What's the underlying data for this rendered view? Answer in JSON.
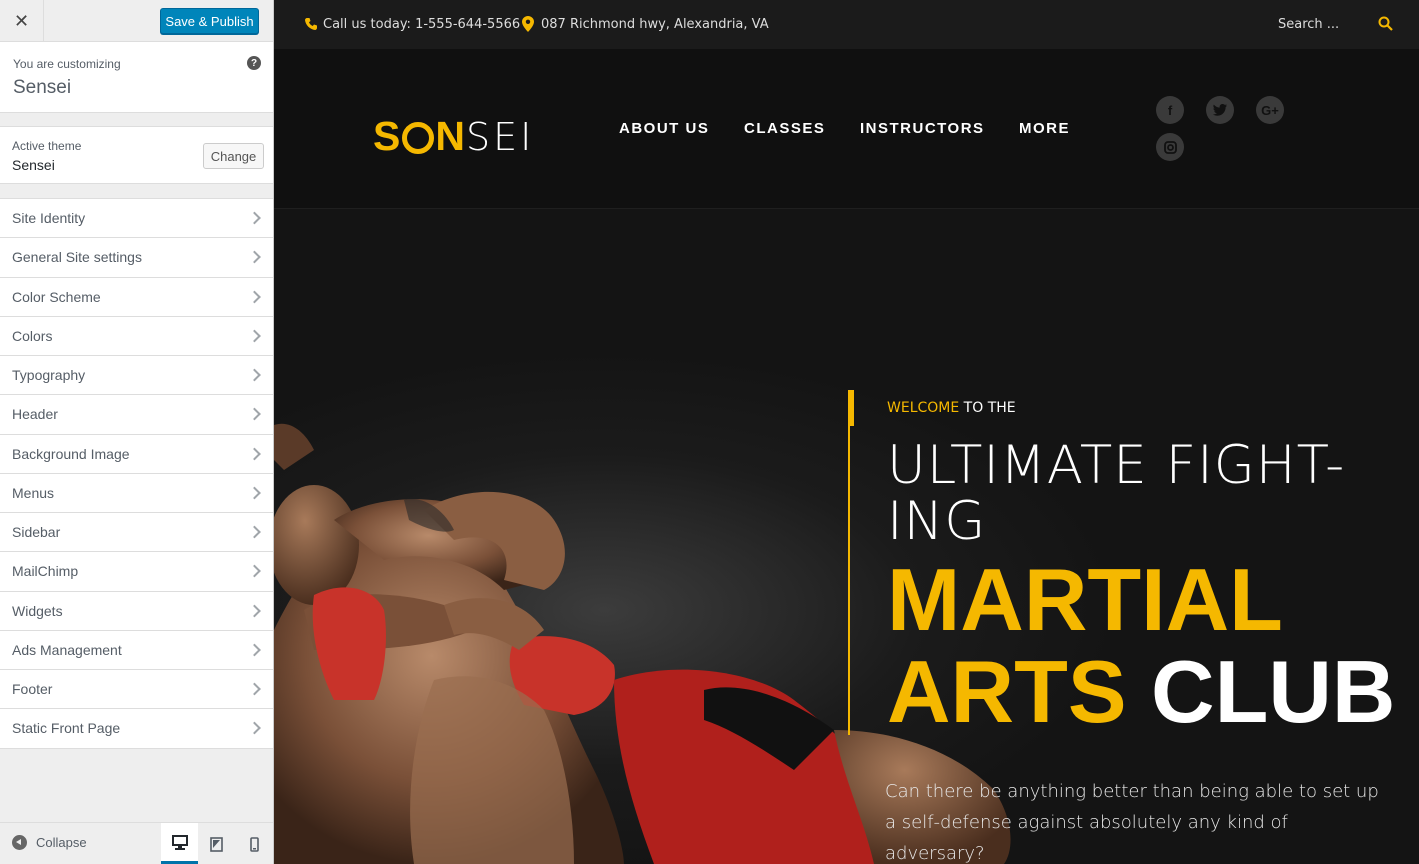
{
  "customizer": {
    "close_icon": "close-icon",
    "save_publish": "Save & Publish",
    "customizing_label": "You are customizing",
    "customizing_title": "Sensei",
    "help_icon": "?",
    "active_theme_label": "Active theme",
    "active_theme_name": "Sensei",
    "change_label": "Change",
    "sections": [
      "Site Identity",
      "General Site settings",
      "Color Scheme",
      "Colors",
      "Typography",
      "Header",
      "Background Image",
      "Menus",
      "Sidebar",
      "MailChimp",
      "Widgets",
      "Ads Management",
      "Footer",
      "Static Front Page"
    ],
    "collapse_label": "Collapse",
    "devices": [
      "desktop",
      "tablet",
      "mobile"
    ],
    "selected_device": "desktop"
  },
  "site": {
    "topbar": {
      "phone_text": "Call us today: 1-555-644-5566",
      "address_text": "087 Richmond hwy, Alexandria, VA",
      "search_placeholder": "Search ..."
    },
    "logo": {
      "part1": "S",
      "part2": "N",
      "part3": "SEI"
    },
    "nav": [
      "ABOUT US",
      "CLASSES",
      "INSTRUCTORS",
      "MORE"
    ],
    "social": [
      "facebook",
      "twitter",
      "google-plus",
      "instagram"
    ],
    "hero": {
      "welcome_highlight": "WELCOME",
      "welcome_rest": " TO THE",
      "title_line1": "ULTIMATE FIGHT-ING",
      "title_line2": "MARTIAL",
      "title_line3a": "ARTS",
      "title_line3b": " CLUB",
      "description": "Can there be anything better than being able to set up a self-defense against absolutely any kind of adversary?"
    }
  },
  "colors": {
    "accent": "#f5b800",
    "wp_primary": "#0085ba",
    "dark_bg": "#141414"
  }
}
